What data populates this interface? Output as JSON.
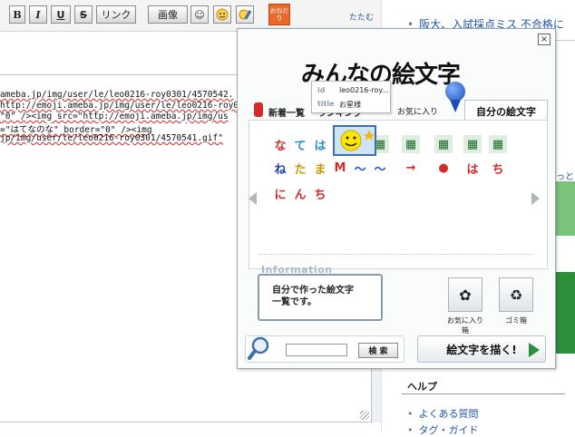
{
  "toolbar": {
    "bold": "B",
    "italic": "I",
    "underline": "U",
    "strike": "S",
    "link": "リンク",
    "image": "画像",
    "onedari": "おねだり",
    "collapse": "たたむ"
  },
  "editor": {
    "lines": [
      "ameba.jp/img/user/le/leo0216-roy0301/4570542.",
      "http://emoji.ameba.jp/img/user/le/leo0216-roy0",
      "\"0\" /><img src=\"http://emoji.ameba.jp/img/us",
      "=\"はてなのな\" border=\"0\" /><img",
      "jp/img/user/le/leo0216-roy0301/4570541.gif\""
    ]
  },
  "popup": {
    "title": "みんなの絵文字",
    "close": "×",
    "tabs": {
      "new": "新着一覧",
      "ranking": "ランキング",
      "favorites": "お気に入り",
      "mine": "自分の絵文字"
    },
    "emoji_row1": [
      "な",
      "て",
      "は",
      "☺",
      "☰",
      "▦",
      "▦",
      "▦",
      "▦",
      "▦"
    ],
    "emoji_row2": [
      "ね",
      "た",
      "ま",
      "M",
      "〜",
      "〜",
      "→",
      "●",
      "は",
      "ち"
    ],
    "emoji_row3": [
      "に",
      "ん",
      "ち"
    ],
    "info_heading": "Information",
    "info_text_1": "自分で作った絵文字",
    "info_text_2": "一覧です。",
    "fav_box_label": "お気に入り箱",
    "trash_box_label": "ゴミ箱",
    "search_placeholder": "",
    "search_button": "検 索",
    "draw_button": "絵文字を描く!",
    "tooltip": {
      "id_key": "id",
      "id_value": "leo0216-roy...",
      "title_key": "title",
      "title_value": "お星様"
    }
  },
  "sidebar": {
    "news": "阪大、入試採点ミス 不合格に",
    "motto": "っと見",
    "help_title": "ヘルプ",
    "help_links": [
      "よくある質問",
      "タグ・ガイド"
    ]
  },
  "colors": {
    "accent_blue": "#1d4fb4",
    "link_blue": "#2255aa",
    "emoji_red": "#d42a2a",
    "emoji_green": "#1e6b2a"
  }
}
